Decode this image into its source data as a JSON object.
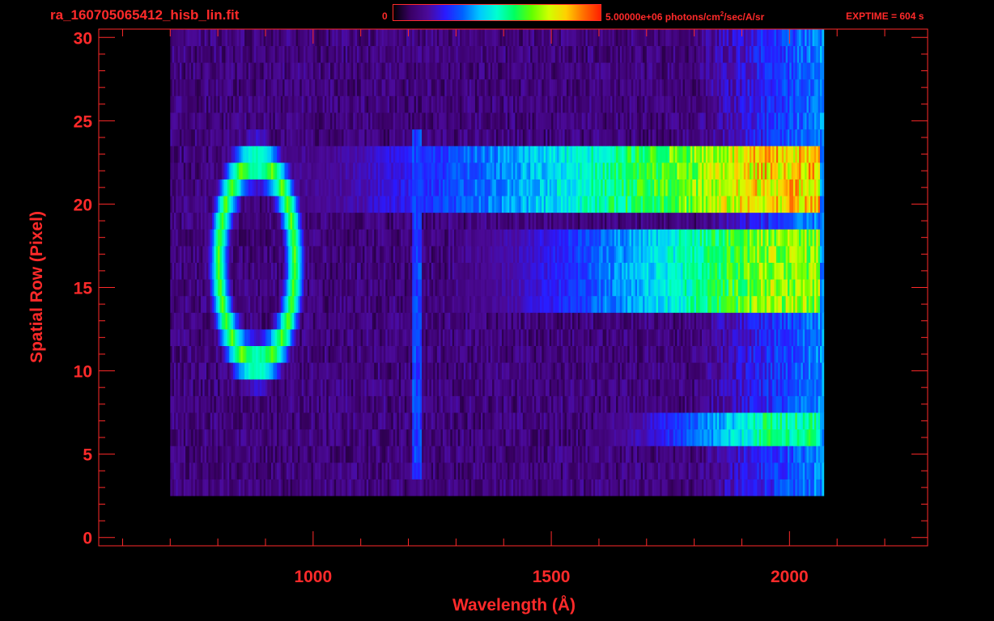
{
  "header": {
    "filename": "ra_160705065412_hisb_lin.fit",
    "colorbar_min": "0",
    "colorbar_max_prefix": "5.00000e+06 photons/cm",
    "colorbar_max_sup": "2",
    "colorbar_max_suffix": "/sec/A/sr",
    "exptime": "EXPTIME = 604 s"
  },
  "colors": {
    "axis": "#ff2a2a",
    "background": "#000000",
    "colormap": [
      "#000000",
      "#3a0066",
      "#4b0a9a",
      "#2a1aff",
      "#0060ff",
      "#00c8ff",
      "#00ffd0",
      "#00ff60",
      "#60ff00",
      "#d0ff00",
      "#ffd000",
      "#ff7000",
      "#ff2000"
    ]
  },
  "chart_data": {
    "type": "heatmap",
    "title": "",
    "xlabel": "Wavelength (Å)",
    "ylabel": "Spatial Row (Pixel)",
    "xlim": [
      550,
      2290
    ],
    "ylim": [
      -0.5,
      30.5
    ],
    "xticks": [
      1000,
      1500,
      2000
    ],
    "xtick_labels": [
      "1000",
      "1500",
      "2000"
    ],
    "yticks": [
      0,
      5,
      10,
      15,
      20,
      25,
      30
    ],
    "ytick_labels": [
      "0",
      "5",
      "10",
      "15",
      "20",
      "25",
      "30"
    ],
    "colorbar": {
      "min": 0,
      "max": 5000000,
      "units": "photons/cm^2/sec/A/sr",
      "scale": "linear"
    },
    "grid": false,
    "features": [
      {
        "name": "ring",
        "center_wavelength": 880,
        "center_row": 16.5,
        "half_width_wavelength": 80,
        "half_height_rows": 6,
        "peak": 0.65
      },
      {
        "name": "line",
        "wavelength": 1216,
        "row_range": [
          4,
          24
        ],
        "peak": 0.35
      },
      {
        "name": "band",
        "wavelength_range": [
          930,
          2060
        ],
        "row_range": [
          20,
          23
        ],
        "peak_wavelength": 1950,
        "peak": 0.82
      },
      {
        "name": "band",
        "wavelength_range": [
          1300,
          2060
        ],
        "row_range": [
          14,
          18
        ],
        "peak_wavelength": 1950,
        "peak": 0.7
      },
      {
        "name": "band",
        "wavelength_range": [
          1600,
          2060
        ],
        "row_range": [
          6,
          7
        ],
        "peak_wavelength": 1950,
        "peak": 0.55
      }
    ],
    "data_extent": {
      "wavelength_range": [
        700,
        2070
      ],
      "row_range": [
        3,
        30
      ]
    }
  }
}
